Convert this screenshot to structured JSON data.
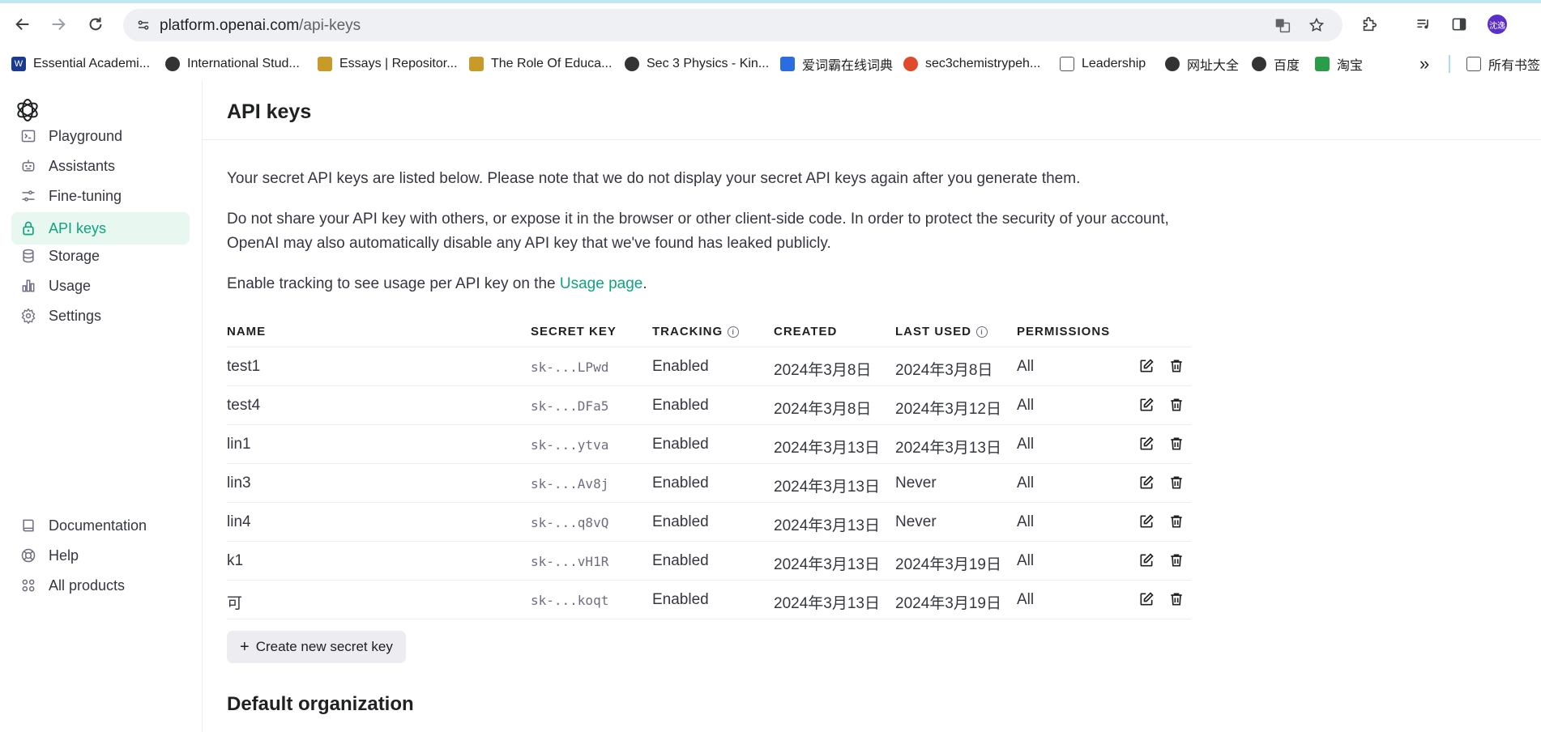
{
  "browser": {
    "url_host": "platform.openai.com",
    "url_path": "/api-keys",
    "profile_initials": "沈逸",
    "bookmarks": [
      {
        "label": "Essential Academi...",
        "color": "#1a3c8f"
      },
      {
        "label": "International Stud...",
        "color": "#333333"
      },
      {
        "label": "Essays | Repositor...",
        "color": "#c89a2a"
      },
      {
        "label": "The Role Of Educa...",
        "color": "#c89a2a"
      },
      {
        "label": "Sec 3 Physics - Kin...",
        "color": "#333333"
      },
      {
        "label": "爱词霸在线词典",
        "color": "#2b6de0"
      },
      {
        "label": "sec3chemistrypeh...",
        "color": "#e04a2b"
      },
      {
        "label": "Leadership",
        "color": "#555555"
      },
      {
        "label": "网址大全",
        "color": "#333333"
      },
      {
        "label": "百度",
        "color": "#333333"
      },
      {
        "label": "淘宝",
        "color": "#2a9d4a"
      }
    ],
    "bookmarks_overflow": "»",
    "all_bookmarks": "所有书签"
  },
  "sidebar": {
    "items": [
      {
        "label": "Playground",
        "icon": "terminal-icon"
      },
      {
        "label": "Assistants",
        "icon": "robot-icon"
      },
      {
        "label": "Fine-tuning",
        "icon": "sliders-icon"
      },
      {
        "label": "API keys",
        "icon": "lock-icon",
        "active": true
      },
      {
        "label": "Storage",
        "icon": "database-icon"
      },
      {
        "label": "Usage",
        "icon": "bar-chart-icon"
      },
      {
        "label": "Settings",
        "icon": "gear-icon"
      }
    ],
    "bottom_items": [
      {
        "label": "Documentation",
        "icon": "book-icon"
      },
      {
        "label": "Help",
        "icon": "lifebuoy-icon"
      },
      {
        "label": "All products",
        "icon": "grid-icon"
      }
    ]
  },
  "page": {
    "title": "API keys",
    "para1": "Your secret API keys are listed below. Please note that we do not display your secret API keys again after you generate them.",
    "para2": "Do not share your API key with others, or expose it in the browser or other client-side code. In order to protect the security of your account, OpenAI may also automatically disable any API key that we've found has leaked publicly.",
    "para3_prefix": "Enable tracking to see usage per API key on the ",
    "para3_link": "Usage page",
    "para3_suffix": ".",
    "create_button": "Create new secret key",
    "section_title": "Default organization"
  },
  "table": {
    "headers": {
      "name": "NAME",
      "secret_key": "SECRET KEY",
      "tracking": "TRACKING",
      "created": "CREATED",
      "last_used": "LAST USED",
      "permissions": "PERMISSIONS"
    },
    "rows": [
      {
        "name": "test1",
        "key": "sk-...LPwd",
        "tracking": "Enabled",
        "created": "2024年3月8日",
        "last_used": "2024年3月8日",
        "permissions": "All"
      },
      {
        "name": "test4",
        "key": "sk-...DFa5",
        "tracking": "Enabled",
        "created": "2024年3月8日",
        "last_used": "2024年3月12日",
        "permissions": "All"
      },
      {
        "name": "lin1",
        "key": "sk-...ytva",
        "tracking": "Enabled",
        "created": "2024年3月13日",
        "last_used": "2024年3月13日",
        "permissions": "All"
      },
      {
        "name": "lin3",
        "key": "sk-...Av8j",
        "tracking": "Enabled",
        "created": "2024年3月13日",
        "last_used": "Never",
        "permissions": "All"
      },
      {
        "name": "lin4",
        "key": "sk-...q8vQ",
        "tracking": "Enabled",
        "created": "2024年3月13日",
        "last_used": "Never",
        "permissions": "All"
      },
      {
        "name": "k1",
        "key": "sk-...vH1R",
        "tracking": "Enabled",
        "created": "2024年3月13日",
        "last_used": "2024年3月19日",
        "permissions": "All"
      },
      {
        "name": "可",
        "key": "sk-...koqt",
        "tracking": "Enabled",
        "created": "2024年3月13日",
        "last_used": "2024年3月19日",
        "permissions": "All"
      }
    ]
  },
  "colors": {
    "accent": "#10a37f",
    "active_bg": "#e8f7ef"
  }
}
